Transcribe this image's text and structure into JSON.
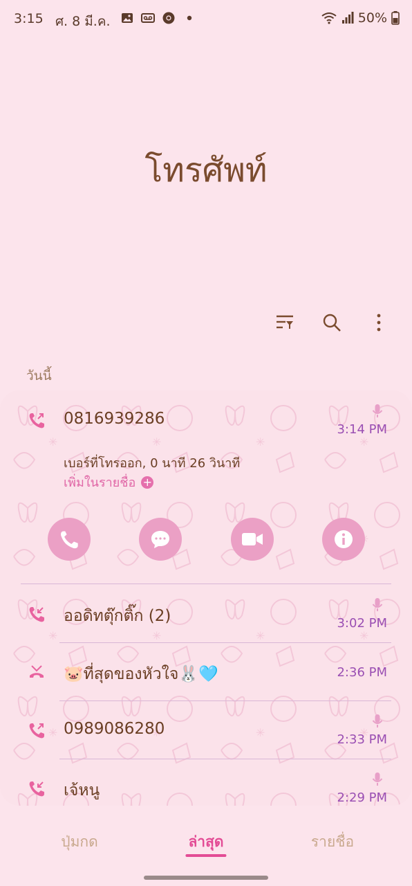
{
  "status_bar": {
    "time": "3:15",
    "date": "ศ. 8 มี.ค.",
    "notification_icons": [
      "image-icon",
      "voicemail-icon",
      "chrome-icon",
      "dot-icon"
    ],
    "battery": "50%",
    "system_icons": [
      "wifi-icon",
      "signal-icon",
      "battery-icon"
    ]
  },
  "header": {
    "title": "โทรศัพท์"
  },
  "toolbar": {
    "icons": [
      "filter-icon",
      "search-icon",
      "more-options-icon"
    ]
  },
  "section": {
    "label": "วันนี้"
  },
  "calls": [
    {
      "name": "0816939286",
      "time": "3:14 PM",
      "type": "outgoing",
      "recorded": true,
      "details": "เบอร์ที่โทรออก, 0 นาที 26 วินาที",
      "add_contact": "เพิ่มในรายชื่อ"
    },
    {
      "name": "ออดิทตุ๊กติ๊ก (2)",
      "time": "3:02 PM",
      "type": "incoming",
      "recorded": true
    },
    {
      "name": "🐷ที่สุดของหัวใจ🐰🩵",
      "time": "2:36 PM",
      "type": "missed",
      "recorded": false
    },
    {
      "name": "0989086280",
      "time": "2:33 PM",
      "type": "outgoing",
      "recorded": true
    },
    {
      "name": "เจ้หนู",
      "time": "2:29 PM",
      "type": "incoming",
      "recorded": true
    }
  ],
  "actions": [
    "call-icon",
    "message-icon",
    "video-call-icon",
    "info-icon"
  ],
  "colors": {
    "background": "#fce4ec",
    "accent": "#e34c95",
    "title": "#7a4b2e",
    "time": "#9a4fb3",
    "action": "#eba0c5"
  },
  "bottom_nav": {
    "keypad": "ปุ่มกด",
    "recents": "ล่าสุด",
    "contacts": "รายชื่อ",
    "active": "recents"
  }
}
